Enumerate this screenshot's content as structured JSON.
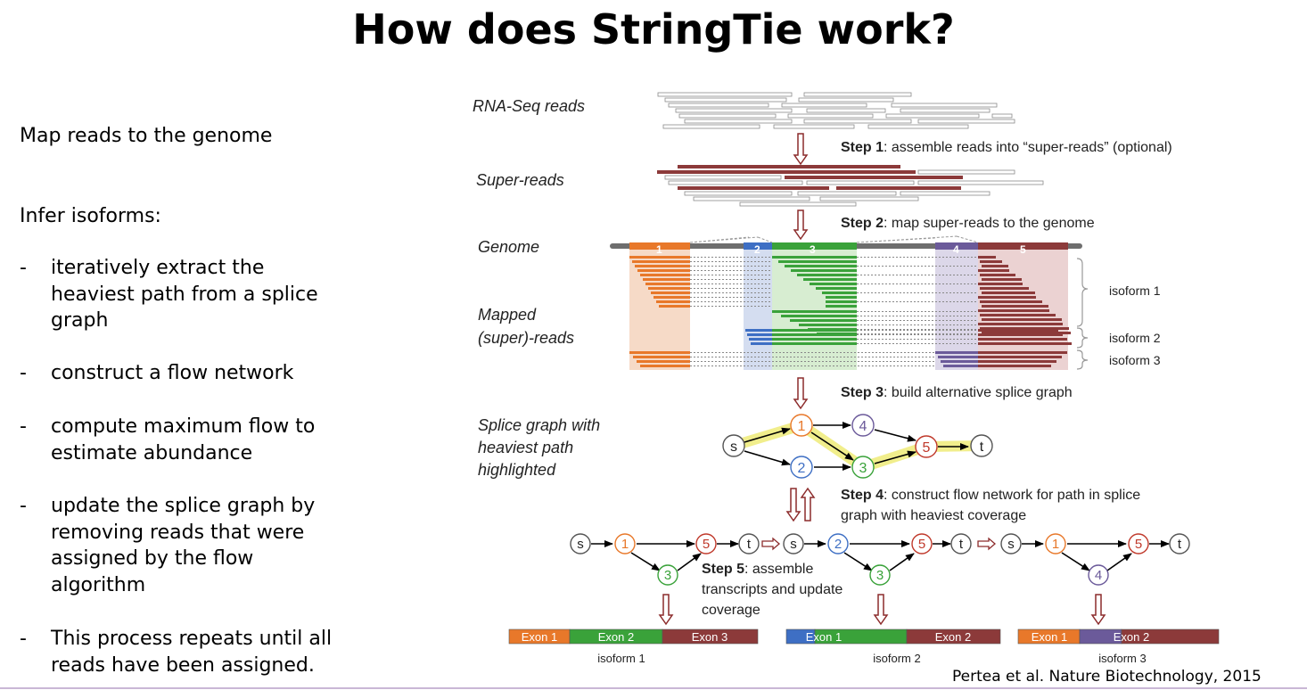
{
  "title": "How does StringTie work?",
  "left": {
    "intro": "Map reads to the genome",
    "heading": "Infer isoforms:",
    "bullet_mark": "-",
    "bullets": [
      {
        "lines": [
          "iteratively extract the",
          "heaviest path from a splice",
          "graph"
        ]
      },
      {
        "lines": [
          "construct a flow network"
        ]
      },
      {
        "lines": [
          "compute maximum flow to",
          "estimate abundance"
        ]
      },
      {
        "lines": [
          "update the splice graph by",
          "removing reads that were",
          "assigned by the flow",
          "algorithm"
        ]
      },
      {
        "lines": [
          "This process repeats until all",
          "reads have been assigned."
        ]
      }
    ]
  },
  "diagram": {
    "labels": {
      "rnaseq": "RNA-Seq reads",
      "superreads": "Super-reads",
      "genome": "Genome",
      "mapped1": "Mapped",
      "mapped2": "(super)-reads",
      "splice1": "Splice graph with",
      "splice2": "heaviest path",
      "splice3": "highlighted"
    },
    "steps": {
      "s1_bold": "Step 1",
      "s1_text": ": assemble reads into “super-reads” (optional)",
      "s2_bold": "Step 2",
      "s2_text": ": map super-reads to the genome",
      "s3_bold": "Step 3",
      "s3_text": ": build alternative splice graph",
      "s4_bold": "Step 4",
      "s4_text1": ": construct flow network for path in splice",
      "s4_text2": "graph with heaviest coverage",
      "s5_bold": "Step 5",
      "s5_text1": ":  assemble",
      "s5_text2": "transcripts and update",
      "s5_text3": "coverage"
    },
    "exon_numbers": [
      "1",
      "2",
      "3",
      "4",
      "5"
    ],
    "isoform_labels": [
      "isoform 1",
      "isoform 2",
      "isoform 3"
    ],
    "node_labels": {
      "s": "s",
      "t": "t",
      "n1": "1",
      "n2": "2",
      "n3": "3",
      "n4": "4",
      "n5": "5"
    },
    "bottom_isoforms": [
      {
        "name": "isoform 1",
        "exons": [
          "Exon 1",
          "Exon 2",
          "Exon 3"
        ]
      },
      {
        "name": "isoform 2",
        "exons": [
          "Exon 1",
          "Exon 2"
        ]
      },
      {
        "name": "isoform 3",
        "exons": [
          "Exon 1",
          "Exon 2"
        ]
      }
    ],
    "colors": {
      "exon1": "#e8782a",
      "exon2": "#3e6fc4",
      "exon3": "#3aa23a",
      "exon4": "#6b5a9a",
      "exon5": "#8c3a3a",
      "read": "#b0b0b0",
      "arrow": "#8c2b2b",
      "highlight": "#f3f08a"
    }
  },
  "citation": "Pertea et al. Nature Biotechnology, 2015"
}
